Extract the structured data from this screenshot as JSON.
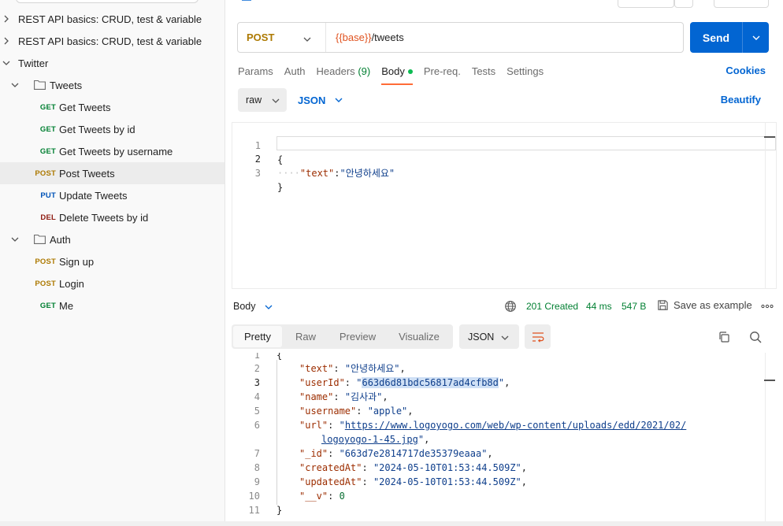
{
  "sidebar": {
    "items": [
      {
        "label": "REST API basics: CRUD, test & variable"
      },
      {
        "label": "REST API basics: CRUD, test & variable"
      },
      {
        "label": "Twitter"
      },
      {
        "label": "Tweets"
      },
      {
        "method": "GET",
        "label": "Get Tweets"
      },
      {
        "method": "GET",
        "label": "Get Tweets by id"
      },
      {
        "method": "GET",
        "label": "Get Tweets by username"
      },
      {
        "method": "POST",
        "label": "Post Tweets"
      },
      {
        "method": "PUT",
        "label": "Update Tweets"
      },
      {
        "method": "DEL",
        "label": "Delete Tweets by id"
      },
      {
        "label": "Auth"
      },
      {
        "method": "POST",
        "label": "Sign up"
      },
      {
        "method": "POST",
        "label": "Login"
      },
      {
        "method": "GET",
        "label": "Me"
      }
    ]
  },
  "request": {
    "method": "POST",
    "url_var": "{{base}}",
    "url_path": "/tweets",
    "send_label": "Send",
    "tabs": {
      "params": "Params",
      "auth": "Auth",
      "headers": "Headers",
      "headers_count": "(9)",
      "body": "Body",
      "prereq": "Pre-req.",
      "tests": "Tests",
      "settings": "Settings"
    },
    "cookies_label": "Cookies",
    "body_mode": "raw",
    "body_format": "JSON",
    "beautify_label": "Beautify",
    "code": {
      "line_numbers": [
        "1",
        "2",
        "3"
      ],
      "open_brace": "{",
      "key": "\"text\"",
      "colon": ":",
      "value": "\"안녕하세요\"",
      "close_brace": "}"
    }
  },
  "response": {
    "body_label": "Body",
    "status": "201 Created",
    "time": "44 ms",
    "size": "547 B",
    "save_label": "Save as example",
    "more_label": "ooo",
    "view_tabs": {
      "pretty": "Pretty",
      "raw": "Raw",
      "preview": "Preview",
      "visualize": "Visualize"
    },
    "format": "JSON",
    "line_numbers": [
      "1",
      "2",
      "3",
      "4",
      "5",
      "6",
      "",
      "7",
      "8",
      "9",
      "10",
      "11"
    ],
    "json": {
      "open": "{",
      "text_key": "\"text\"",
      "text_val": "\"안녕하세요\"",
      "userId_key": "\"userId\"",
      "userId_val": "663d6d81bdc56817ad4cfb8d",
      "name_key": "\"name\"",
      "name_val": "\"김사과\"",
      "username_key": "\"username\"",
      "username_val": "\"apple\"",
      "url_key": "\"url\"",
      "url_val_1": "https://www.logoyogo.com/web/wp-content/uploads/edd/2021/02/",
      "url_val_2": "logoyogo-1-45.jpg",
      "id_key": "\"_id\"",
      "id_val": "\"663d7e2814717de35379eaaa\"",
      "createdAt_key": "\"createdAt\"",
      "createdAt_val": "\"2024-05-10T01:53:44.509Z\"",
      "updatedAt_key": "\"updatedAt\"",
      "updatedAt_val": "\"2024-05-10T01:53:44.509Z\"",
      "v_key": "\"__v\"",
      "v_val": "0",
      "close": "}"
    }
  }
}
